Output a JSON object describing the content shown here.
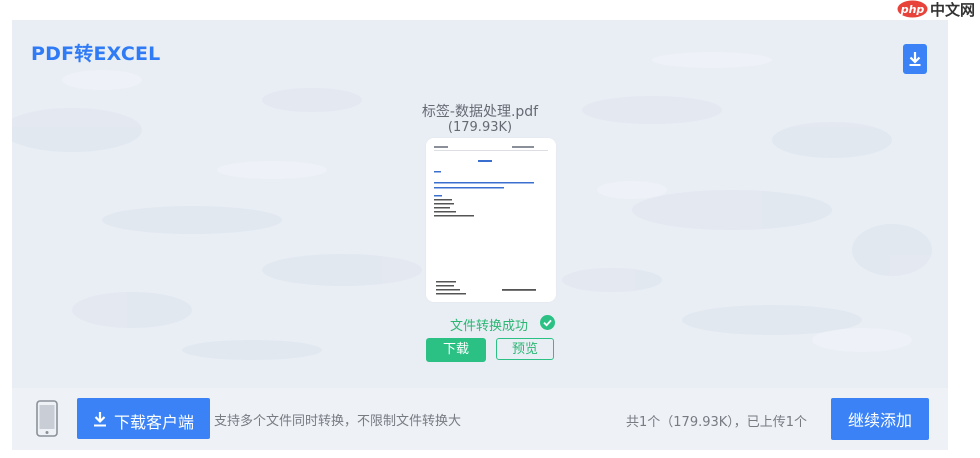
{
  "panel": {
    "title": "PDF转EXCEL",
    "download_icon": "download-icon"
  },
  "file": {
    "name": "标签-数据处理.pdf",
    "size": "(179.93K)",
    "status": "文件转换成功",
    "status_icon": "check-circle-icon",
    "download_label": "下载",
    "preview_label": "预览"
  },
  "bottom_bar": {
    "phone_icon": "mobile-phone-icon",
    "client_button_label": "下载客户端",
    "client_button_icon": "download-arrow-icon",
    "hint": "支持多个文件同时转换，不限制文件转换大",
    "count_text": "共1个（179.93K），已上传1个",
    "add_button_label": "继续添加"
  },
  "watermark": {
    "logo": "php",
    "text": "中文网"
  },
  "colors": {
    "brand_blue": "#3a82f6",
    "title_blue": "#2f7bf5",
    "success_green": "#2bc184",
    "panel_bg": "#e9eef5",
    "bar_bg": "#eef1f6"
  }
}
